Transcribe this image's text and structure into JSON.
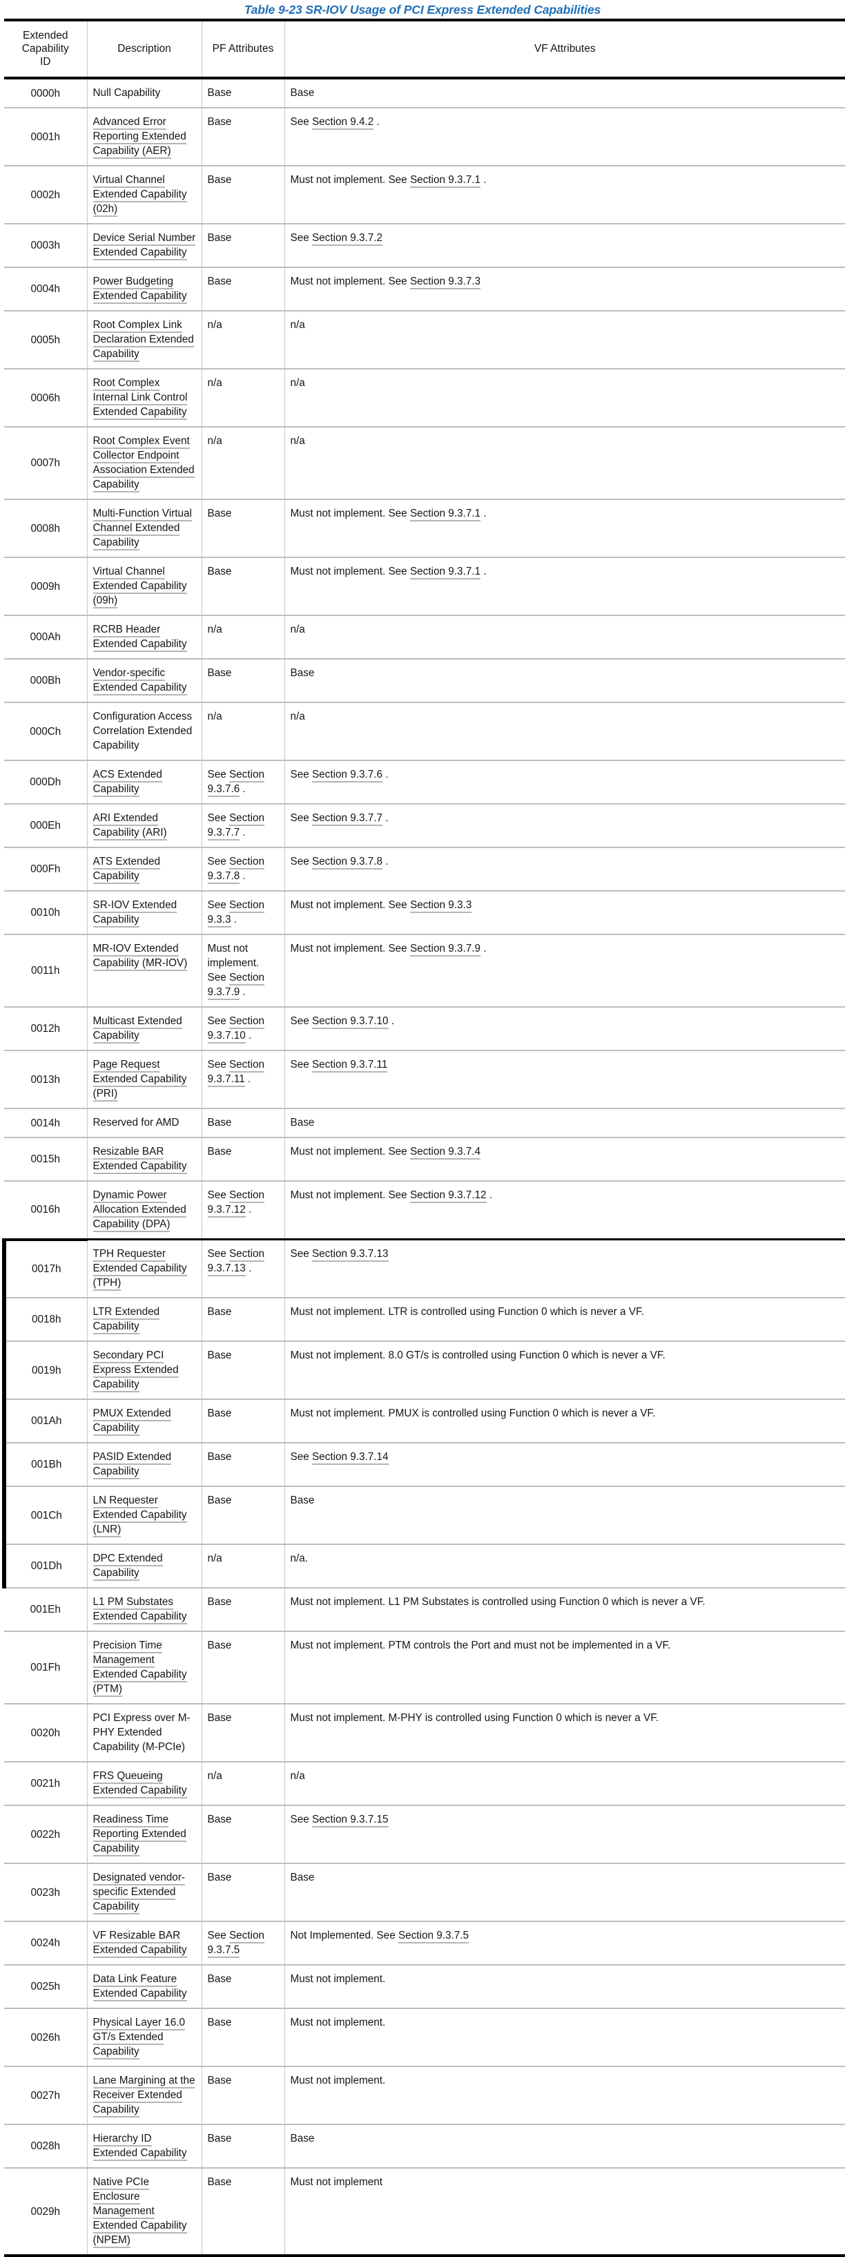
{
  "caption": "Table  9-23  SR-IOV Usage of PCI Express Extended Capabilities",
  "accent_color": "#1f6fb8",
  "rule_color": "#000000",
  "grid_color": "#c6c6c6",
  "link_underline_color": "#b4b4b4",
  "columns": [
    "Extended Capability ID",
    "Description",
    "PF Attributes",
    "VF Attributes"
  ],
  "column_header_lines": [
    [
      "Extended",
      "Capability",
      "ID"
    ],
    [
      "Description"
    ],
    [
      "PF Attributes"
    ],
    [
      "VF Attributes"
    ]
  ],
  "rows": [
    {
      "id": "0000h",
      "desc": "Null Capability",
      "desc_link": false,
      "pf": "Base",
      "pf_link": null,
      "vf": "Base",
      "vf_link": null
    },
    {
      "id": "0001h",
      "desc": "Advanced Error Reporting Extended Capability (AER)",
      "desc_link": true,
      "pf": "Base",
      "pf_link": null,
      "vf": "See Section 9.4.2 .",
      "vf_link": "Section 9.4.2"
    },
    {
      "id": "0002h",
      "desc": "Virtual Channel Extended Capability (02h)",
      "desc_link": true,
      "pf": "Base",
      "pf_link": null,
      "vf": "Must not implement. See Section 9.3.7.1 .",
      "vf_link": "Section 9.3.7.1"
    },
    {
      "id": "0003h",
      "desc": "Device Serial Number Extended Capability",
      "desc_link": true,
      "pf": "Base",
      "pf_link": null,
      "vf": "See Section 9.3.7.2",
      "vf_link": "Section 9.3.7.2"
    },
    {
      "id": "0004h",
      "desc": "Power Budgeting Extended Capability",
      "desc_link": true,
      "pf": "Base",
      "pf_link": null,
      "vf": "Must not implement. See Section 9.3.7.3",
      "vf_link": "Section 9.3.7.3"
    },
    {
      "id": "0005h",
      "desc": "Root Complex Link Declaration Extended Capability",
      "desc_link": true,
      "pf": "n/a",
      "pf_link": null,
      "vf": "n/a",
      "vf_link": null
    },
    {
      "id": "0006h",
      "desc": "Root Complex Internal Link Control Extended Capability",
      "desc_link": true,
      "pf": "n/a",
      "pf_link": null,
      "vf": "n/a",
      "vf_link": null
    },
    {
      "id": "0007h",
      "desc": "Root Complex Event Collector Endpoint Association Extended Capability",
      "desc_link": true,
      "pf": "n/a",
      "pf_link": null,
      "vf": "n/a",
      "vf_link": null
    },
    {
      "id": "0008h",
      "desc": "Multi-Function Virtual Channel Extended Capability",
      "desc_link": true,
      "pf": "Base",
      "pf_link": null,
      "vf": "Must not implement. See Section 9.3.7.1 .",
      "vf_link": "Section 9.3.7.1"
    },
    {
      "id": "0009h",
      "desc": "Virtual Channel Extended Capability (09h)",
      "desc_link": true,
      "pf": "Base",
      "pf_link": null,
      "vf": "Must not implement. See Section 9.3.7.1 .",
      "vf_link": "Section 9.3.7.1"
    },
    {
      "id": "000Ah",
      "desc": "RCRB Header Extended Capability",
      "desc_link": true,
      "pf": "n/a",
      "pf_link": null,
      "vf": "n/a",
      "vf_link": null
    },
    {
      "id": "000Bh",
      "desc": "Vendor-specific Extended Capability",
      "desc_link": true,
      "pf": "Base",
      "pf_link": null,
      "vf": "Base",
      "vf_link": null
    },
    {
      "id": "000Ch",
      "desc": "Configuration Access Correlation Extended Capability",
      "desc_link": false,
      "pf": "n/a",
      "pf_link": null,
      "vf": "n/a",
      "vf_link": null
    },
    {
      "id": "000Dh",
      "desc": "ACS Extended Capability",
      "desc_link": true,
      "pf": "See Section 9.3.7.6 .",
      "pf_link": "Section 9.3.7.6",
      "vf": "See Section 9.3.7.6 .",
      "vf_link": "Section 9.3.7.6"
    },
    {
      "id": "000Eh",
      "desc": "ARI Extended Capability (ARI)",
      "desc_link": true,
      "pf": "See Section 9.3.7.7 .",
      "pf_link": "Section 9.3.7.7",
      "vf": "See Section 9.3.7.7 .",
      "vf_link": "Section 9.3.7.7"
    },
    {
      "id": "000Fh",
      "desc": "ATS Extended Capability",
      "desc_link": true,
      "pf": "See Section 9.3.7.8 .",
      "pf_link": "Section 9.3.7.8",
      "vf": "See Section 9.3.7.8 .",
      "vf_link": "Section 9.3.7.8"
    },
    {
      "id": "0010h",
      "desc": "SR-IOV Extended Capability",
      "desc_link": true,
      "pf": "See Section 9.3.3 .",
      "pf_link": "Section 9.3.3",
      "vf": "Must not implement. See Section 9.3.3",
      "vf_link": "Section 9.3.3"
    },
    {
      "id": "0011h",
      "desc": "MR-IOV Extended Capability (MR-IOV)",
      "desc_link": true,
      "pf": "Must not implement. See Section 9.3.7.9 .",
      "pf_link": "Section 9.3.7.9",
      "vf": "Must not implement. See Section 9.3.7.9 .",
      "vf_link": "Section 9.3.7.9"
    },
    {
      "id": "0012h",
      "desc": "Multicast Extended Capability",
      "desc_link": true,
      "pf": "See Section 9.3.7.10 .",
      "pf_link": "Section 9.3.7.10",
      "vf": "See Section 9.3.7.10 .",
      "vf_link": "Section 9.3.7.10"
    },
    {
      "id": "0013h",
      "desc": "Page Request Extended Capability (PRI)",
      "desc_link": true,
      "pf": "See Section 9.3.7.11 .",
      "pf_link": "Section 9.3.7.11",
      "vf": "See Section 9.3.7.11",
      "vf_link": "Section 9.3.7.11"
    },
    {
      "id": "0014h",
      "desc": "Reserved for AMD",
      "desc_link": false,
      "pf": "Base",
      "pf_link": null,
      "vf": "Base",
      "vf_link": null
    },
    {
      "id": "0015h",
      "desc": "Resizable BAR Extended Capability",
      "desc_link": true,
      "pf": "Base",
      "pf_link": null,
      "vf": "Must not implement. See Section 9.3.7.4",
      "vf_link": "Section 9.3.7.4"
    },
    {
      "id": "0016h",
      "desc": "Dynamic Power Allocation Extended Capability (DPA)",
      "desc_link": true,
      "pf": "See Section 9.3.7.12 .",
      "pf_link": "Section 9.3.7.12",
      "vf": "Must not implement. See Section 9.3.7.12 .",
      "vf_link": "Section 9.3.7.12"
    },
    {
      "id": "0017h",
      "desc": "TPH Requester Extended Capability (TPH)",
      "desc_link": true,
      "pf": "See Section 9.3.7.13 .",
      "pf_link": "Section 9.3.7.13",
      "vf": "See Section 9.3.7.13",
      "vf_link": "Section 9.3.7.13",
      "page_break_above": true
    },
    {
      "id": "0018h",
      "desc": "LTR Extended Capability",
      "desc_link": true,
      "pf": "Base",
      "pf_link": null,
      "vf": "Must not implement. LTR is controlled using Function 0 which is never a VF.",
      "vf_link": null
    },
    {
      "id": "0019h",
      "desc": "Secondary PCI Express Extended Capability",
      "desc_link": true,
      "pf": "Base",
      "pf_link": null,
      "vf": "Must not implement. 8.0 GT/s is controlled using Function 0 which is never a VF.",
      "vf_link": null
    },
    {
      "id": "001Ah",
      "desc": "PMUX Extended Capability",
      "desc_link": true,
      "pf": "Base",
      "pf_link": null,
      "vf": "Must not implement. PMUX is controlled using Function 0 which is never a VF.",
      "vf_link": null
    },
    {
      "id": "001Bh",
      "desc": "PASID Extended Capability",
      "desc_link": true,
      "pf": "Base",
      "pf_link": null,
      "vf": "See Section 9.3.7.14",
      "vf_link": "Section 9.3.7.14"
    },
    {
      "id": "001Ch",
      "desc": "LN Requester Extended Capability (LNR)",
      "desc_link": true,
      "pf": "Base",
      "pf_link": null,
      "vf": "Base",
      "vf_link": null
    },
    {
      "id": "001Dh",
      "desc": "DPC Extended Capability",
      "desc_link": true,
      "pf": "n/a",
      "pf_link": null,
      "vf": "n/a.",
      "vf_link": null
    },
    {
      "id": "001Eh",
      "desc": "L1 PM Substates Extended Capability",
      "desc_link": true,
      "pf": "Base",
      "pf_link": null,
      "vf": "Must not implement. L1 PM Substates is controlled using Function 0 which is never a VF.",
      "vf_link": null
    },
    {
      "id": "001Fh",
      "desc": "Precision Time Management Extended Capability (PTM)",
      "desc_link": true,
      "pf": "Base",
      "pf_link": null,
      "vf": "Must not implement. PTM controls the Port and must not be implemented in a VF.",
      "vf_link": null
    },
    {
      "id": "0020h",
      "desc": "PCI Express over M-PHY Extended Capability (M-PCIe)",
      "desc_link": false,
      "pf": "Base",
      "pf_link": null,
      "vf": "Must not implement. M-PHY is controlled using Function 0 which is never a VF.",
      "vf_link": null
    },
    {
      "id": "0021h",
      "desc": "FRS Queueing Extended Capability",
      "desc_link": true,
      "pf": "n/a",
      "pf_link": null,
      "vf": "n/a",
      "vf_link": null
    },
    {
      "id": "0022h",
      "desc": "Readiness Time Reporting Extended Capability",
      "desc_link": true,
      "pf": "Base",
      "pf_link": null,
      "vf": "See Section 9.3.7.15",
      "vf_link": "Section 9.3.7.15"
    },
    {
      "id": "0023h",
      "desc": "Designated vendor-specific Extended Capability",
      "desc_link": true,
      "pf": "Base",
      "pf_link": null,
      "vf": "Base",
      "vf_link": null
    },
    {
      "id": "0024h",
      "desc": "VF Resizable BAR Extended Capability",
      "desc_link": true,
      "pf": "See Section 9.3.7.5",
      "pf_link": "Section 9.3.7.5",
      "vf": "Not Implemented. See Section 9.3.7.5",
      "vf_link": "Section 9.3.7.5"
    },
    {
      "id": "0025h",
      "desc": "Data Link Feature Extended Capability",
      "desc_link": true,
      "pf": "Base",
      "pf_link": null,
      "vf": "Must not implement.",
      "vf_link": null
    },
    {
      "id": "0026h",
      "desc": "Physical Layer 16.0 GT/s Extended Capability",
      "desc_link": true,
      "pf": "Base",
      "pf_link": null,
      "vf": "Must not implement.",
      "vf_link": null
    },
    {
      "id": "0027h",
      "desc": "Lane Margining at the Receiver Extended Capability",
      "desc_link": true,
      "pf": "Base",
      "pf_link": null,
      "vf": "Must not implement.",
      "vf_link": null
    },
    {
      "id": "0028h",
      "desc": "Hierarchy ID Extended Capability",
      "desc_link": true,
      "pf": "Base",
      "pf_link": null,
      "vf": "Base",
      "vf_link": null
    },
    {
      "id": "0029h",
      "desc": "Native PCIe Enclosure Management Extended Capability (NPEM)",
      "desc_link": true,
      "pf": "Base",
      "pf_link": null,
      "vf": "Must not implement",
      "vf_link": null
    }
  ],
  "left_bar_rows": [
    "0017h",
    "0018h",
    "0019h",
    "001Ah",
    "001Bh",
    "001Ch",
    "001Dh"
  ],
  "row_heights": {
    "0000h": 33,
    "0001h": 54,
    "0002h": 54,
    "0003h": 54,
    "0004h": 33,
    "0005h": 54,
    "0006h": 54,
    "0007h": 54,
    "0008h": 54,
    "0009h": 54,
    "000Ah": 33,
    "000Bh": 33,
    "000Ch": 54,
    "000Dh": 33,
    "000Eh": 33,
    "000Fh": 33,
    "0010h": 33,
    "0011h": 54,
    "0012h": 33,
    "0013h": 33,
    "0014h": 33,
    "0015h": 33,
    "0016h": 54,
    "0017h": 54,
    "0018h": 54,
    "0019h": 54,
    "001Ah": 54,
    "001Bh": 33,
    "001Ch": 33,
    "001Dh": 33,
    "001Eh": 54,
    "001Fh": 54,
    "0020h": 54,
    "0021h": 33,
    "0022h": 54,
    "0023h": 54,
    "0024h": 33,
    "0025h": 33,
    "0026h": 54,
    "0027h": 54,
    "0028h": 33,
    "0029h": 54
  }
}
